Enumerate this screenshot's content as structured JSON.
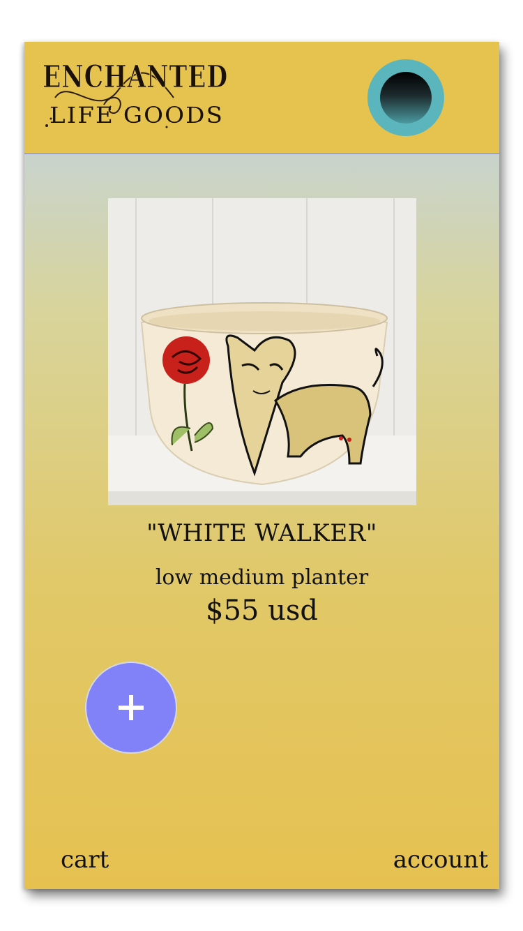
{
  "brand": {
    "logo_line1": "ENCHANTED",
    "logo_line2": "LIFE GOODS",
    "logo_icon": "enchanted-life-goods-logo"
  },
  "header": {
    "avatar_icon": "profile-avatar-icon",
    "accent_color": "#5bb5bd"
  },
  "product": {
    "image_icon": "product-photo-planter",
    "title": "\"WHITE WALKER\"",
    "description": "low medium planter",
    "price": "$55 usd"
  },
  "actions": {
    "add_icon": "plus-icon",
    "add_color": "#8181f8"
  },
  "nav": {
    "cart_label": "cart",
    "account_label": "account"
  }
}
